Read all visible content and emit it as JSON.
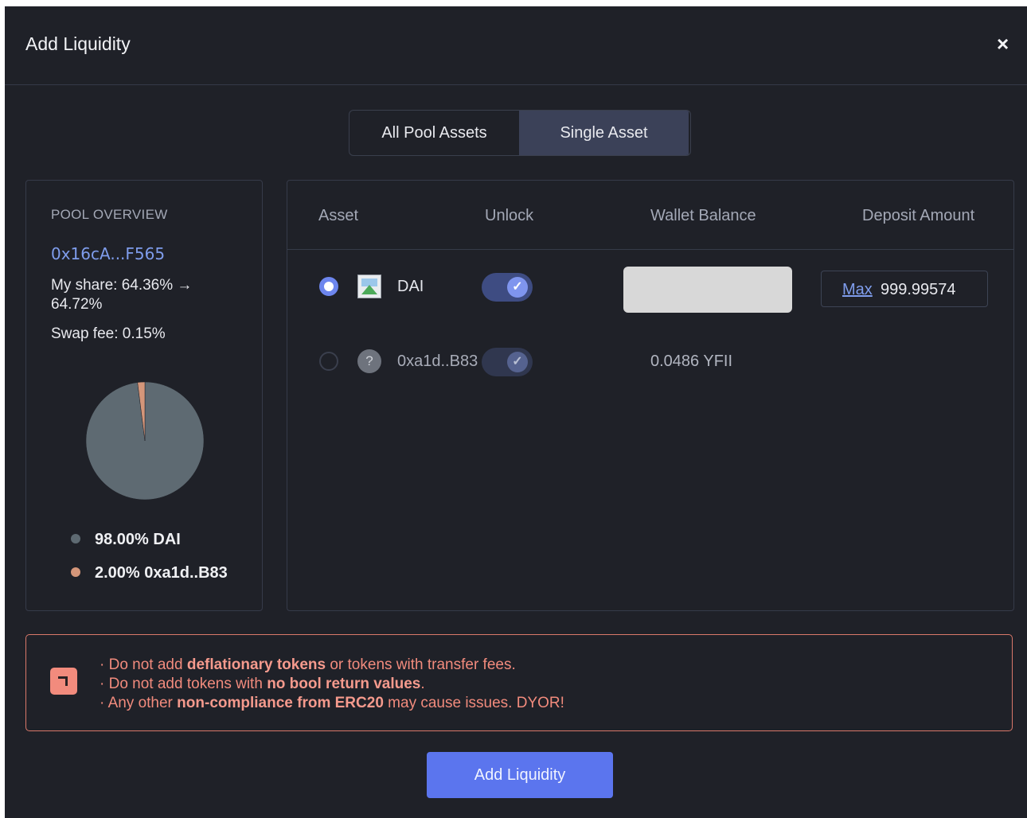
{
  "modal": {
    "title": "Add Liquidity",
    "close_label": "×"
  },
  "tabs": [
    {
      "label": "All Pool Assets",
      "active": false
    },
    {
      "label": "Single Asset",
      "active": true
    }
  ],
  "pool_overview": {
    "heading": "POOL OVERVIEW",
    "address": "0x16cA...F565",
    "my_share": "My share: 64.36% → 64.72%",
    "swap_fee": "Swap fee: 0.15%",
    "breakdown": [
      {
        "label": "98.00% DAI",
        "percent": 98.0,
        "color": "#5e6a72"
      },
      {
        "label": "2.00% 0xa1d..B83",
        "percent": 2.0,
        "color": "#d4967a"
      }
    ]
  },
  "table": {
    "headers": {
      "asset": "Asset",
      "unlock": "Unlock",
      "wallet_balance": "Wallet Balance",
      "deposit_amount": "Deposit Amount"
    },
    "rows": [
      {
        "token": "DAI",
        "selected": true,
        "unlocked": true,
        "wallet_balance": "",
        "max_label": "Max",
        "deposit_value": "999.99574"
      },
      {
        "token": "0xa1d..B83",
        "selected": false,
        "unlocked": true,
        "wallet_balance": "0.0486 YFII"
      }
    ]
  },
  "warning": {
    "line1_pre": "Do not add ",
    "line1_bold": "deflationary tokens",
    "line1_post": " or tokens with transfer fees.",
    "line2_pre": "Do not add tokens with ",
    "line2_bold": "no bool return values",
    "line2_post": ".",
    "line3_pre": "Any other ",
    "line3_bold": "non-compliance from ERC20",
    "line3_post": " may cause issues. DYOR!",
    "bullet": "·"
  },
  "submit_label": "Add Liquidity",
  "colors": {
    "background": "#1f2128",
    "accent": "#5b75ee",
    "link": "#7f9dec",
    "warning": "#f28b7d"
  }
}
